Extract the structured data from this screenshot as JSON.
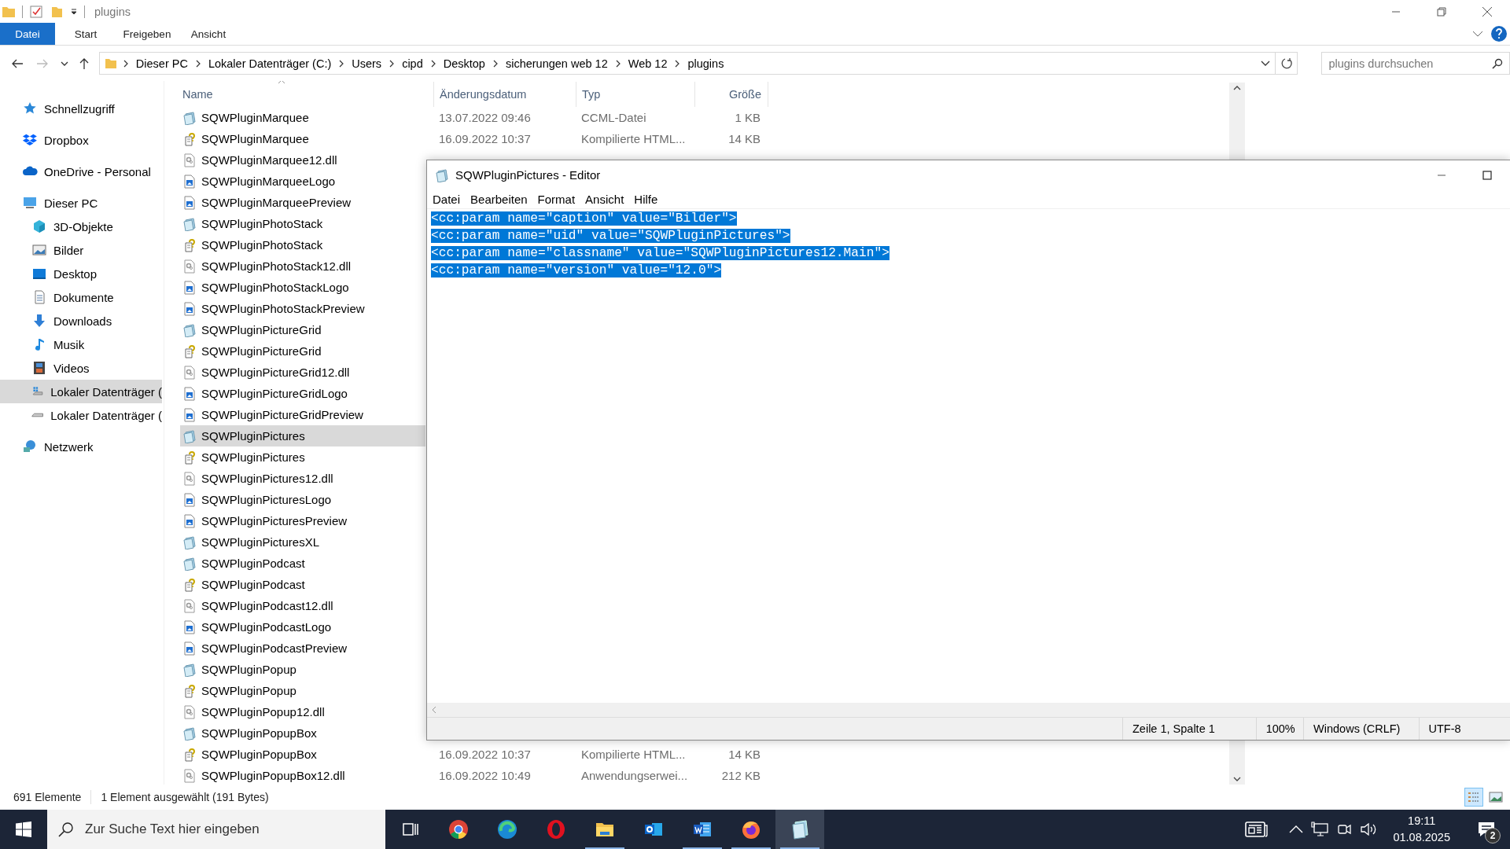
{
  "window": {
    "title": "plugins"
  },
  "ribbon_tabs": [
    {
      "label": "Datei",
      "selected": true
    },
    {
      "label": "Start",
      "selected": false
    },
    {
      "label": "Freigeben",
      "selected": false
    },
    {
      "label": "Ansicht",
      "selected": false
    }
  ],
  "address": {
    "breadcrumbs": [
      "Dieser PC",
      "Lokaler Datenträger (C:)",
      "Users",
      "cipd",
      "Desktop",
      "sicherungen web 12",
      "Web 12",
      "plugins"
    ],
    "search": {
      "placeholder": "plugins durchsuchen"
    }
  },
  "sidebar": {
    "items": [
      {
        "label": "Schnellzugriff",
        "kind": "star",
        "selected": false
      },
      {
        "label": "Dropbox",
        "kind": "dropbox",
        "selected": false
      },
      {
        "label": "OneDrive - Personal",
        "kind": "cloud",
        "selected": false
      },
      {
        "label": "Dieser PC",
        "kind": "pc",
        "selected": false,
        "children": [
          {
            "label": "3D-Objekte",
            "kind": "cube",
            "selected": false
          },
          {
            "label": "Bilder",
            "kind": "pictures",
            "selected": false
          },
          {
            "label": "Desktop",
            "kind": "desktop",
            "selected": false
          },
          {
            "label": "Dokumente",
            "kind": "documents",
            "selected": false
          },
          {
            "label": "Downloads",
            "kind": "download",
            "selected": false
          },
          {
            "label": "Musik",
            "kind": "music",
            "selected": false
          },
          {
            "label": "Videos",
            "kind": "film",
            "selected": false
          },
          {
            "label": "Lokaler Datenträger (",
            "kind": "windrive",
            "selected": true
          },
          {
            "label": "Lokaler Datenträger (",
            "kind": "drive",
            "selected": false
          }
        ]
      },
      {
        "label": "Netzwerk",
        "kind": "network",
        "selected": false
      }
    ]
  },
  "file_list": {
    "columns": [
      "Name",
      "Änderungsdatum",
      "Typ",
      "Größe"
    ],
    "rows": [
      {
        "name": "SQWPluginMarquee",
        "kind": "cc",
        "selected": false,
        "date": "13.07.2022 09:46",
        "type": "CCML-Datei",
        "size": "1 KB"
      },
      {
        "name": "SQWPluginMarquee",
        "kind": "chm",
        "selected": false,
        "date": "16.09.2022 10:37",
        "type": "Kompilierte HTML...",
        "size": "14 KB"
      },
      {
        "name": "SQWPluginMarquee12.dll",
        "kind": "dll",
        "selected": false
      },
      {
        "name": "SQWPluginMarqueeLogo",
        "kind": "img",
        "selected": false
      },
      {
        "name": "SQWPluginMarqueePreview",
        "kind": "img",
        "selected": false
      },
      {
        "name": "SQWPluginPhotoStack",
        "kind": "cc",
        "selected": false
      },
      {
        "name": "SQWPluginPhotoStack",
        "kind": "chm",
        "selected": false
      },
      {
        "name": "SQWPluginPhotoStack12.dll",
        "kind": "dll",
        "selected": false
      },
      {
        "name": "SQWPluginPhotoStackLogo",
        "kind": "img",
        "selected": false
      },
      {
        "name": "SQWPluginPhotoStackPreview",
        "kind": "img",
        "selected": false
      },
      {
        "name": "SQWPluginPictureGrid",
        "kind": "cc",
        "selected": false
      },
      {
        "name": "SQWPluginPictureGrid",
        "kind": "chm",
        "selected": false
      },
      {
        "name": "SQWPluginPictureGrid12.dll",
        "kind": "dll",
        "selected": false
      },
      {
        "name": "SQWPluginPictureGridLogo",
        "kind": "img",
        "selected": false
      },
      {
        "name": "SQWPluginPictureGridPreview",
        "kind": "img",
        "selected": false
      },
      {
        "name": "SQWPluginPictures",
        "kind": "cc",
        "selected": true
      },
      {
        "name": "SQWPluginPictures",
        "kind": "chm",
        "selected": false
      },
      {
        "name": "SQWPluginPictures12.dll",
        "kind": "dll",
        "selected": false
      },
      {
        "name": "SQWPluginPicturesLogo",
        "kind": "img",
        "selected": false
      },
      {
        "name": "SQWPluginPicturesPreview",
        "kind": "img",
        "selected": false
      },
      {
        "name": "SQWPluginPicturesXL",
        "kind": "cc",
        "selected": false
      },
      {
        "name": "SQWPluginPodcast",
        "kind": "cc",
        "selected": false
      },
      {
        "name": "SQWPluginPodcast",
        "kind": "chm",
        "selected": false
      },
      {
        "name": "SQWPluginPodcast12.dll",
        "kind": "dll",
        "selected": false
      },
      {
        "name": "SQWPluginPodcastLogo",
        "kind": "img",
        "selected": false
      },
      {
        "name": "SQWPluginPodcastPreview",
        "kind": "img",
        "selected": false
      },
      {
        "name": "SQWPluginPopup",
        "kind": "cc",
        "selected": false
      },
      {
        "name": "SQWPluginPopup",
        "kind": "chm",
        "selected": false
      },
      {
        "name": "SQWPluginPopup12.dll",
        "kind": "dll",
        "selected": false
      },
      {
        "name": "SQWPluginPopupBox",
        "kind": "cc",
        "selected": false
      },
      {
        "name": "SQWPluginPopupBox",
        "kind": "chm",
        "selected": false,
        "date": "16.09.2022 10:37",
        "type": "Kompilierte HTML...",
        "size": "14 KB"
      },
      {
        "name": "SQWPluginPopupBox12.dll",
        "kind": "dll",
        "selected": false,
        "date": "16.09.2022 10:49",
        "type": "Anwendungserwei...",
        "size": "212 KB"
      }
    ]
  },
  "status_bar": {
    "count": "691 Elemente",
    "selection": "1 Element ausgewählt (191 Bytes)"
  },
  "view_buttons": [
    {
      "kind": "details",
      "selected": true
    },
    {
      "kind": "large_icons",
      "selected": false
    }
  ],
  "editor": {
    "title": "SQWPluginPictures - Editor",
    "menu": [
      "Datei",
      "Bearbeiten",
      "Format",
      "Ansicht",
      "Hilfe"
    ],
    "lines": [
      {
        "text": "<cc:param name=\"caption\" value=\"Bilder\">",
        "selected": true
      },
      {
        "text": "<cc:param name=\"uid\" value=\"SQWPluginPictures\">",
        "selected": true
      },
      {
        "text": "<cc:param name=\"classname\" value=\"SQWPluginPictures12.Main\">",
        "selected": true
      },
      {
        "text": "<cc:param name=\"version\" value=\"12.0\">",
        "selected": true
      }
    ],
    "status": [
      "Zeile 1, Spalte 1",
      "100%",
      "Windows (CRLF)",
      "UTF-8"
    ]
  },
  "taskbar": {
    "search": {
      "placeholder": "Zur Suche Text hier eingeben"
    },
    "apps": [
      {
        "kind": "taskview",
        "running": false,
        "selected": false
      },
      {
        "kind": "chrome",
        "running": false,
        "selected": false
      },
      {
        "kind": "edge",
        "running": false,
        "selected": false
      },
      {
        "kind": "opera",
        "running": false,
        "selected": false
      },
      {
        "kind": "explorer",
        "running": true,
        "selected": false
      },
      {
        "kind": "outlook",
        "running": false,
        "selected": false
      },
      {
        "kind": "word",
        "running": true,
        "selected": false
      },
      {
        "kind": "firefox",
        "running": true,
        "selected": false
      },
      {
        "kind": "notepad",
        "running": true,
        "selected": true
      }
    ],
    "time": "19:11",
    "date": "01.08.2025",
    "notifications": "2"
  }
}
